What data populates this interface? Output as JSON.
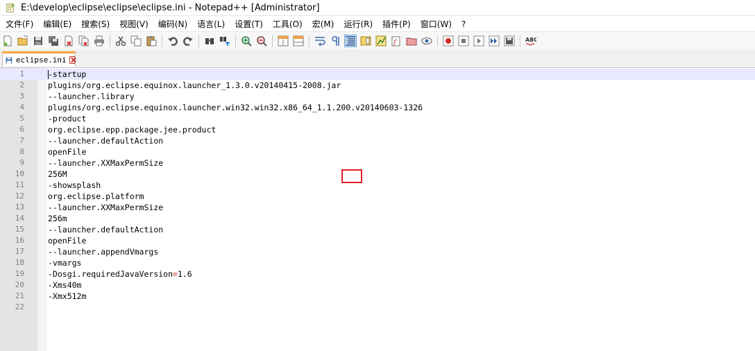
{
  "window": {
    "title": "E:\\develop\\eclipse\\eclipse\\eclipse.ini - Notepad++ [Administrator]"
  },
  "menu": [
    {
      "label": "文件(F)"
    },
    {
      "label": "编辑(E)"
    },
    {
      "label": "搜索(S)"
    },
    {
      "label": "视图(V)"
    },
    {
      "label": "编码(N)"
    },
    {
      "label": "语言(L)"
    },
    {
      "label": "设置(T)"
    },
    {
      "label": "工具(O)"
    },
    {
      "label": "宏(M)"
    },
    {
      "label": "运行(R)"
    },
    {
      "label": "插件(P)"
    },
    {
      "label": "窗口(W)"
    },
    {
      "label": "?"
    }
  ],
  "toolbar": {
    "icons": [
      "new-file-icon",
      "open-file-icon",
      "save-icon",
      "save-all-icon",
      "close-icon",
      "close-all-icon",
      "print-icon",
      "cut-icon",
      "copy-icon",
      "paste-icon",
      "undo-icon",
      "redo-icon",
      "find-icon",
      "replace-icon",
      "zoom-in-icon",
      "zoom-out-icon",
      "sync-vertical-icon",
      "sync-horizontal-icon",
      "word-wrap-icon",
      "show-all-chars-icon",
      "indent-guide-icon",
      "doc-map-icon",
      "function-list-icon",
      "folder-workspace-icon",
      "monitoring-icon",
      "record-macro-icon",
      "stop-macro-icon",
      "play-macro-icon",
      "run-macro-multiple-icon",
      "save-macro-icon",
      "spell-check-icon"
    ],
    "active_icon": "indent-guide-icon",
    "spell_label": "ABC"
  },
  "tabs": [
    {
      "label": "eclipse.ini",
      "active": true
    }
  ],
  "editor": {
    "current_line": 1,
    "lines": [
      {
        "num": "1",
        "text": "-startup"
      },
      {
        "num": "2",
        "text": "plugins/org.eclipse.equinox.launcher_1.3.0.v20140415-2008.jar"
      },
      {
        "num": "3",
        "text": "--launcher.library"
      },
      {
        "num": "4",
        "text": "plugins/org.eclipse.equinox.launcher.win32.win32.x86_64_1.1.200.v20140603-1326"
      },
      {
        "num": "5",
        "text": "-product"
      },
      {
        "num": "6",
        "text": "org.eclipse.epp.package.jee.product"
      },
      {
        "num": "7",
        "text": "--launcher.defaultAction"
      },
      {
        "num": "8",
        "text": "openFile"
      },
      {
        "num": "9",
        "text": "--launcher.XXMaxPermSize"
      },
      {
        "num": "10",
        "text": "256M"
      },
      {
        "num": "11",
        "text": "-showsplash"
      },
      {
        "num": "12",
        "text": "org.eclipse.platform"
      },
      {
        "num": "13",
        "text": "--launcher.XXMaxPermSize"
      },
      {
        "num": "14",
        "text": "256m"
      },
      {
        "num": "15",
        "text": "--launcher.defaultAction"
      },
      {
        "num": "16",
        "text": "openFile"
      },
      {
        "num": "17",
        "text": "--launcher.appendVmargs"
      },
      {
        "num": "18",
        "text": "-vmargs"
      },
      {
        "num": "19",
        "text": "-Dosgi.requiredJavaVersion=1.6",
        "key": "-Dosgi.requiredJavaVersion",
        "op": "=",
        "value": "1.6"
      },
      {
        "num": "20",
        "text": "-Xms40m"
      },
      {
        "num": "21",
        "text": "-Xmx512m"
      },
      {
        "num": "22",
        "text": ""
      }
    ]
  },
  "colors": {
    "current_line_bg": "#e8e8ff",
    "highlight_box": "#e02020",
    "tab_accent": "#f8a440",
    "operator": "#e01e1e"
  }
}
